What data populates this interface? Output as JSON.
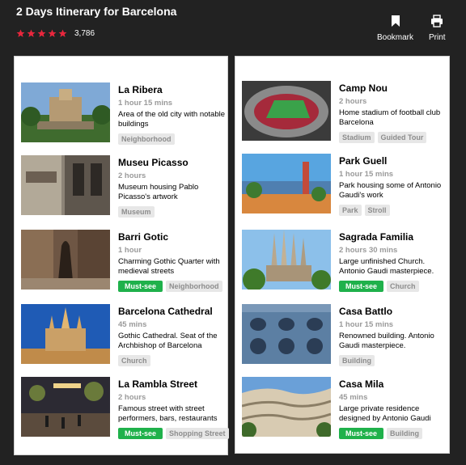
{
  "header": {
    "title": "2 Days Itinerary for Barcelona",
    "rating": {
      "stars": 5,
      "count": "3,786",
      "color": "#e8273d"
    },
    "bookmark_label": "Bookmark",
    "print_label": "Print"
  },
  "colors": {
    "must_see": "#1fb14b",
    "tag_bg": "#e7e7e7",
    "background": "#222222"
  },
  "day1": {
    "items": [
      {
        "name": "La Ribera",
        "duration": "1 hour 15 mins",
        "description": "Area of the old city with notable buildings",
        "tags": [
          "Neighborhood"
        ]
      },
      {
        "name": "Museu Picasso",
        "duration": "2 hours",
        "description": "Museum housing Pablo Picasso's artwork",
        "tags": [
          "Museum"
        ]
      },
      {
        "name": "Barri Gotic",
        "duration": "1 hour",
        "description": "Charming Gothic Quarter with medieval streets",
        "tags": [
          "Must-see",
          "Neighborhood"
        ]
      },
      {
        "name": "Barcelona Cathedral",
        "duration": "45 mins",
        "description": "Gothic Cathedral. Seat of the Archbishop of Barcelona",
        "tags": [
          "Church"
        ]
      },
      {
        "name": "La Rambla Street",
        "duration": "2 hours",
        "description": "Famous street with street performers, bars, restaurants",
        "tags": [
          "Must-see",
          "Shopping Street"
        ]
      }
    ]
  },
  "day2": {
    "items": [
      {
        "name": "Camp Nou",
        "duration": "2 hours",
        "description": "Home stadium of football club Barcelona",
        "tags": [
          "Stadium",
          "Guided Tour"
        ]
      },
      {
        "name": "Park Guell",
        "duration": "1 hour 15 mins",
        "description": "Park housing some of Antonio Gaudi's work",
        "tags": [
          "Park",
          "Stroll"
        ]
      },
      {
        "name": "Sagrada Familia",
        "duration": "2 hours 30 mins",
        "description": "Large unfinished Church. Antonio Gaudi masterpiece.",
        "tags": [
          "Must-see",
          "Church"
        ]
      },
      {
        "name": "Casa Battlo",
        "duration": "1 hour 15 mins",
        "description": "Renowned building. Antonio Gaudi masterpiece.",
        "tags": [
          "Building"
        ]
      },
      {
        "name": "Casa Mila",
        "duration": "45 mins",
        "description": "Large private residence designed by Antonio Gaudi",
        "tags": [
          "Must-see",
          "Building"
        ]
      }
    ]
  }
}
